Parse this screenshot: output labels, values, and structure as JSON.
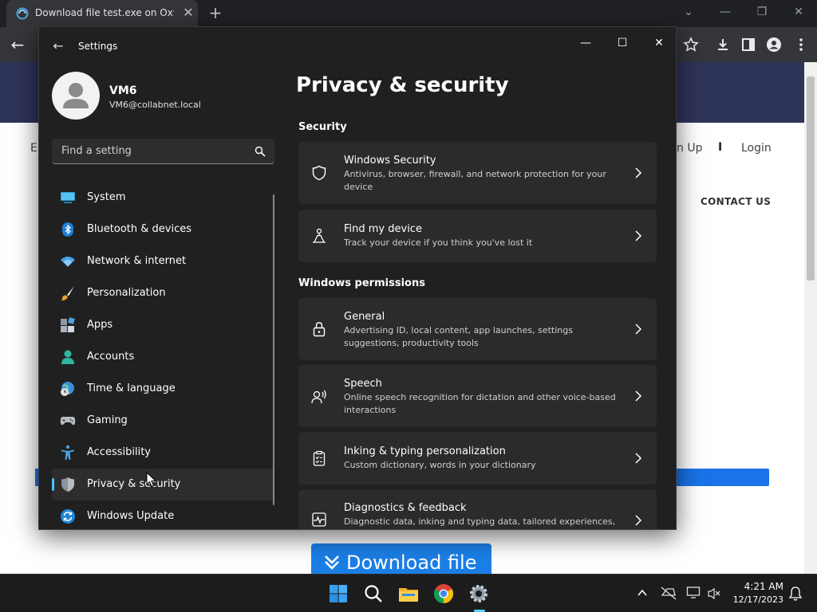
{
  "browser": {
    "tab_title": "Download file test.exe on Oxy.Cl",
    "tab_close": "✕",
    "new_tab": "+",
    "back": "←",
    "minimize": "—",
    "restore": "❐",
    "close": "✕",
    "dropdown": "⌄"
  },
  "website": {
    "nav_left": "E",
    "sign_up": "n Up",
    "separator": "I",
    "login": "Login",
    "contact": "CONTACT US",
    "download_label": "Download file"
  },
  "settings": {
    "title": "Settings",
    "back": "←",
    "minimize": "—",
    "maximize": "☐",
    "close": "✕",
    "user": {
      "name": "VM6",
      "email": "VM6@collabnet.local"
    },
    "search": {
      "placeholder": "Find a setting"
    },
    "nav": [
      {
        "label": "System"
      },
      {
        "label": "Bluetooth & devices"
      },
      {
        "label": "Network & internet"
      },
      {
        "label": "Personalization"
      },
      {
        "label": "Apps"
      },
      {
        "label": "Accounts"
      },
      {
        "label": "Time & language"
      },
      {
        "label": "Gaming"
      },
      {
        "label": "Accessibility"
      },
      {
        "label": "Privacy & security",
        "selected": true
      },
      {
        "label": "Windows Update"
      }
    ],
    "page_title": "Privacy & security",
    "sections": {
      "security": "Security",
      "permissions": "Windows permissions"
    },
    "cards": [
      {
        "title": "Windows Security",
        "desc": "Antivirus, browser, firewall, and network protection for your device",
        "icon": "shield-icon"
      },
      {
        "title": "Find my device",
        "desc": "Track your device if you think you've lost it",
        "icon": "person-pin-icon"
      },
      {
        "title": "General",
        "desc": "Advertising ID, local content, app launches, settings suggestions, productivity tools",
        "icon": "lock-icon"
      },
      {
        "title": "Speech",
        "desc": "Online speech recognition for dictation and other voice-based interactions",
        "icon": "speech-icon"
      },
      {
        "title": "Inking & typing personalization",
        "desc": "Custom dictionary, words in your dictionary",
        "icon": "clipboard-icon"
      },
      {
        "title": "Diagnostics & feedback",
        "desc": "Diagnostic data, inking and typing data, tailored experiences,",
        "icon": "pulse-icon"
      }
    ]
  },
  "taskbar": {
    "time": "4:21 AM",
    "date": "12/17/2023"
  },
  "colors": {
    "accent": "#4cc2ff",
    "settings_bg": "#202020",
    "card_bg": "#2b2b2b",
    "download_blue": "#1b7fe6"
  }
}
